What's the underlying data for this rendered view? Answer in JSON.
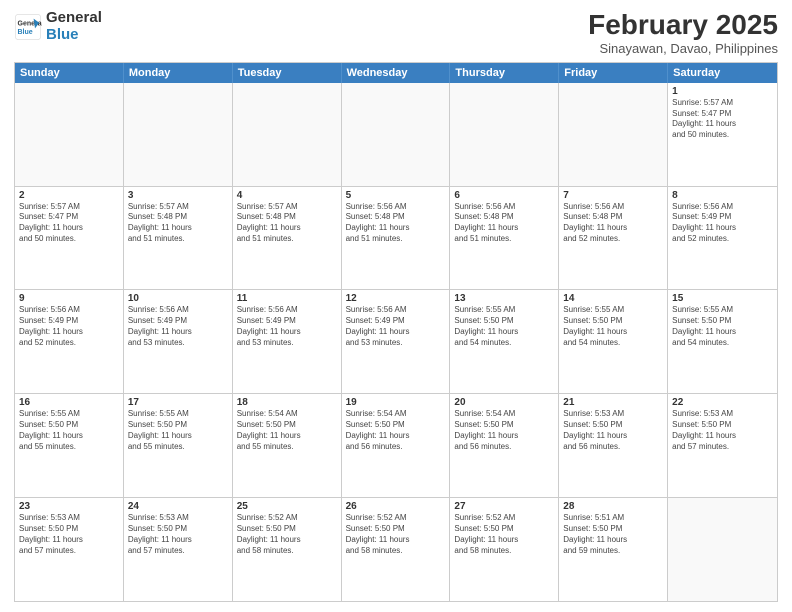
{
  "header": {
    "logo_line1": "General",
    "logo_line2": "Blue",
    "month_title": "February 2025",
    "location": "Sinayawan, Davao, Philippines"
  },
  "weekdays": [
    "Sunday",
    "Monday",
    "Tuesday",
    "Wednesday",
    "Thursday",
    "Friday",
    "Saturday"
  ],
  "rows": [
    [
      {
        "day": "",
        "info": "",
        "empty": true
      },
      {
        "day": "",
        "info": "",
        "empty": true
      },
      {
        "day": "",
        "info": "",
        "empty": true
      },
      {
        "day": "",
        "info": "",
        "empty": true
      },
      {
        "day": "",
        "info": "",
        "empty": true
      },
      {
        "day": "",
        "info": "",
        "empty": true
      },
      {
        "day": "1",
        "info": "Sunrise: 5:57 AM\nSunset: 5:47 PM\nDaylight: 11 hours\nand 50 minutes."
      }
    ],
    [
      {
        "day": "2",
        "info": "Sunrise: 5:57 AM\nSunset: 5:47 PM\nDaylight: 11 hours\nand 50 minutes."
      },
      {
        "day": "3",
        "info": "Sunrise: 5:57 AM\nSunset: 5:48 PM\nDaylight: 11 hours\nand 51 minutes."
      },
      {
        "day": "4",
        "info": "Sunrise: 5:57 AM\nSunset: 5:48 PM\nDaylight: 11 hours\nand 51 minutes."
      },
      {
        "day": "5",
        "info": "Sunrise: 5:56 AM\nSunset: 5:48 PM\nDaylight: 11 hours\nand 51 minutes."
      },
      {
        "day": "6",
        "info": "Sunrise: 5:56 AM\nSunset: 5:48 PM\nDaylight: 11 hours\nand 51 minutes."
      },
      {
        "day": "7",
        "info": "Sunrise: 5:56 AM\nSunset: 5:48 PM\nDaylight: 11 hours\nand 52 minutes."
      },
      {
        "day": "8",
        "info": "Sunrise: 5:56 AM\nSunset: 5:49 PM\nDaylight: 11 hours\nand 52 minutes."
      }
    ],
    [
      {
        "day": "9",
        "info": "Sunrise: 5:56 AM\nSunset: 5:49 PM\nDaylight: 11 hours\nand 52 minutes."
      },
      {
        "day": "10",
        "info": "Sunrise: 5:56 AM\nSunset: 5:49 PM\nDaylight: 11 hours\nand 53 minutes."
      },
      {
        "day": "11",
        "info": "Sunrise: 5:56 AM\nSunset: 5:49 PM\nDaylight: 11 hours\nand 53 minutes."
      },
      {
        "day": "12",
        "info": "Sunrise: 5:56 AM\nSunset: 5:49 PM\nDaylight: 11 hours\nand 53 minutes."
      },
      {
        "day": "13",
        "info": "Sunrise: 5:55 AM\nSunset: 5:50 PM\nDaylight: 11 hours\nand 54 minutes."
      },
      {
        "day": "14",
        "info": "Sunrise: 5:55 AM\nSunset: 5:50 PM\nDaylight: 11 hours\nand 54 minutes."
      },
      {
        "day": "15",
        "info": "Sunrise: 5:55 AM\nSunset: 5:50 PM\nDaylight: 11 hours\nand 54 minutes."
      }
    ],
    [
      {
        "day": "16",
        "info": "Sunrise: 5:55 AM\nSunset: 5:50 PM\nDaylight: 11 hours\nand 55 minutes."
      },
      {
        "day": "17",
        "info": "Sunrise: 5:55 AM\nSunset: 5:50 PM\nDaylight: 11 hours\nand 55 minutes."
      },
      {
        "day": "18",
        "info": "Sunrise: 5:54 AM\nSunset: 5:50 PM\nDaylight: 11 hours\nand 55 minutes."
      },
      {
        "day": "19",
        "info": "Sunrise: 5:54 AM\nSunset: 5:50 PM\nDaylight: 11 hours\nand 56 minutes."
      },
      {
        "day": "20",
        "info": "Sunrise: 5:54 AM\nSunset: 5:50 PM\nDaylight: 11 hours\nand 56 minutes."
      },
      {
        "day": "21",
        "info": "Sunrise: 5:53 AM\nSunset: 5:50 PM\nDaylight: 11 hours\nand 56 minutes."
      },
      {
        "day": "22",
        "info": "Sunrise: 5:53 AM\nSunset: 5:50 PM\nDaylight: 11 hours\nand 57 minutes."
      }
    ],
    [
      {
        "day": "23",
        "info": "Sunrise: 5:53 AM\nSunset: 5:50 PM\nDaylight: 11 hours\nand 57 minutes."
      },
      {
        "day": "24",
        "info": "Sunrise: 5:53 AM\nSunset: 5:50 PM\nDaylight: 11 hours\nand 57 minutes."
      },
      {
        "day": "25",
        "info": "Sunrise: 5:52 AM\nSunset: 5:50 PM\nDaylight: 11 hours\nand 58 minutes."
      },
      {
        "day": "26",
        "info": "Sunrise: 5:52 AM\nSunset: 5:50 PM\nDaylight: 11 hours\nand 58 minutes."
      },
      {
        "day": "27",
        "info": "Sunrise: 5:52 AM\nSunset: 5:50 PM\nDaylight: 11 hours\nand 58 minutes."
      },
      {
        "day": "28",
        "info": "Sunrise: 5:51 AM\nSunset: 5:50 PM\nDaylight: 11 hours\nand 59 minutes."
      },
      {
        "day": "",
        "info": "",
        "empty": true
      }
    ]
  ]
}
